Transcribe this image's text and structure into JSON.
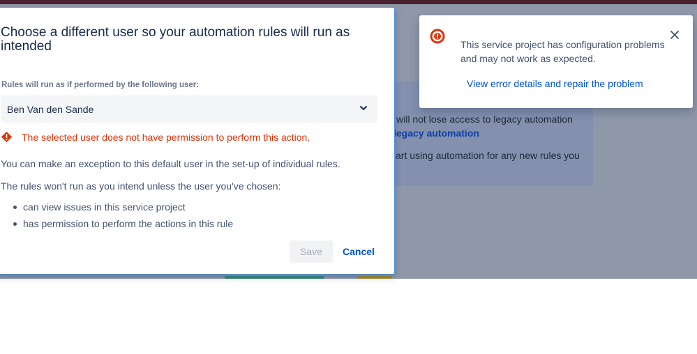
{
  "background": {
    "lines": [
      "will not lose access to legacy automation",
      "legacy automation",
      "art using automation for any new rules you"
    ]
  },
  "modal": {
    "title": "Choose a different user so your automation rules will run as intended",
    "field_label": "Rules will run as if performed by the following user:",
    "selected_user": "Ben Van den Sande",
    "error_message": "The selected user does not have permission to perform this action.",
    "exception_text": "You can make an exception to this default user in the set-up of individual rules.",
    "intro_text": "The rules won't run as you intend unless the user you've chosen:",
    "requirements": [
      "can view issues in this service project",
      "has permission to perform the actions in this rule"
    ],
    "save_label": "Save",
    "cancel_label": "Cancel"
  },
  "toast": {
    "message": "This service project has configuration problems and may not work as expected.",
    "link_label": "View error details and repair the problem",
    "icon": "error-circle-icon"
  },
  "colors": {
    "error": "#de350b",
    "link": "#0052cc",
    "overlay": "#8e98a8"
  }
}
